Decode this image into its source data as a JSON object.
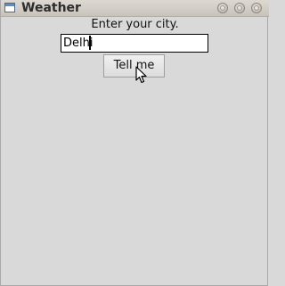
{
  "window": {
    "title": "Weather",
    "icon": "window-app-icon",
    "controls": [
      "minimize-icon",
      "maximize-icon",
      "close-icon"
    ]
  },
  "form": {
    "prompt": "Enter your city.",
    "city_value": "Delhi",
    "submit_label": "Tell me"
  },
  "pointer": "arrow-cursor-icon"
}
